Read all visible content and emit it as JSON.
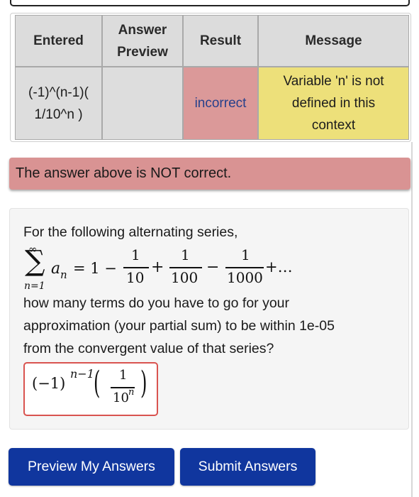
{
  "results_table": {
    "headers": {
      "entered": [
        "Entered"
      ],
      "answer_preview": [
        "Answer",
        "Preview"
      ],
      "result": [
        "Result"
      ],
      "message": [
        "Message"
      ]
    },
    "row": {
      "entered": [
        "(-1)^(n-1)(",
        "1/10^n )"
      ],
      "answer_preview": "",
      "result": "incorrect",
      "message": [
        "Variable 'n' is not",
        "defined in this",
        "context"
      ]
    }
  },
  "alert": {
    "text": "The answer above is NOT correct."
  },
  "problem": {
    "intro": "For the following alternating series,",
    "series": {
      "sum_upper": "∞",
      "sum_lower": "n=1",
      "term": "a",
      "term_sub": "n",
      "equals_one": "= 1 −",
      "fractions": [
        {
          "num": "1",
          "den": "10"
        },
        {
          "num": "1",
          "den": "100"
        },
        {
          "num": "1",
          "den": "1000"
        }
      ],
      "ops": [
        "+",
        "−",
        "+…"
      ]
    },
    "question": [
      "how many terms do you have to go for your",
      "approximation (your partial sum) to be within 1e-05",
      "from the convergent value of that series?"
    ],
    "answer_preview": {
      "base": "(−1)",
      "exponent": "n−1",
      "num": "1",
      "den_base": "10",
      "den_exp": "n"
    }
  },
  "buttons": {
    "preview": "Preview My Answers",
    "submit": "Submit Answers"
  },
  "colors": {
    "incorrect_cell": "#db9999",
    "message_cell": "#ede07a",
    "alert_bg": "#d99393",
    "button_bg": "#10369e",
    "answer_border": "#d9534f"
  }
}
